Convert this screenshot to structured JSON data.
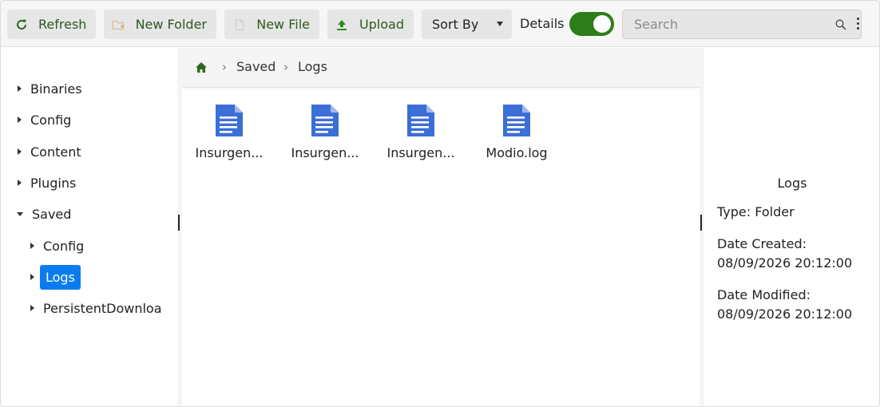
{
  "toolbar": {
    "refresh": "Refresh",
    "new_folder": "New Folder",
    "new_file": "New File",
    "upload": "Upload",
    "sort_by": "Sort By",
    "details_label": "Details",
    "details_on": true,
    "search_placeholder": "Search"
  },
  "colors": {
    "accent_green": "#2e7d1a",
    "selection_blue": "#0a7cf0",
    "file_icon_blue": "#3c6fd6"
  },
  "tree": {
    "items": [
      {
        "label": "Binaries",
        "expanded": false
      },
      {
        "label": "Config",
        "expanded": false
      },
      {
        "label": "Content",
        "expanded": false
      },
      {
        "label": "Plugins",
        "expanded": false
      },
      {
        "label": "Saved",
        "expanded": true
      }
    ],
    "children": [
      {
        "label": "Config",
        "selected": false
      },
      {
        "label": "Logs",
        "selected": true
      },
      {
        "label": "PersistentDownloa",
        "selected": false
      }
    ]
  },
  "breadcrumb": {
    "home_icon": "home-icon",
    "items": [
      "Saved",
      "Logs"
    ],
    "separator": "›"
  },
  "files": [
    {
      "name": "Insurgen...",
      "icon": "document-icon"
    },
    {
      "name": "Insurgen...",
      "icon": "document-icon"
    },
    {
      "name": "Insurgen...",
      "icon": "document-icon"
    },
    {
      "name": "Modio.log",
      "icon": "document-icon"
    }
  ],
  "details": {
    "title": "Logs",
    "type": "Type: Folder",
    "created_label": "Date Created:",
    "created_value": "08/09/2026 20:12:00",
    "modified_label": "Date Modified:",
    "modified_value": "08/09/2026 20:12:00"
  }
}
